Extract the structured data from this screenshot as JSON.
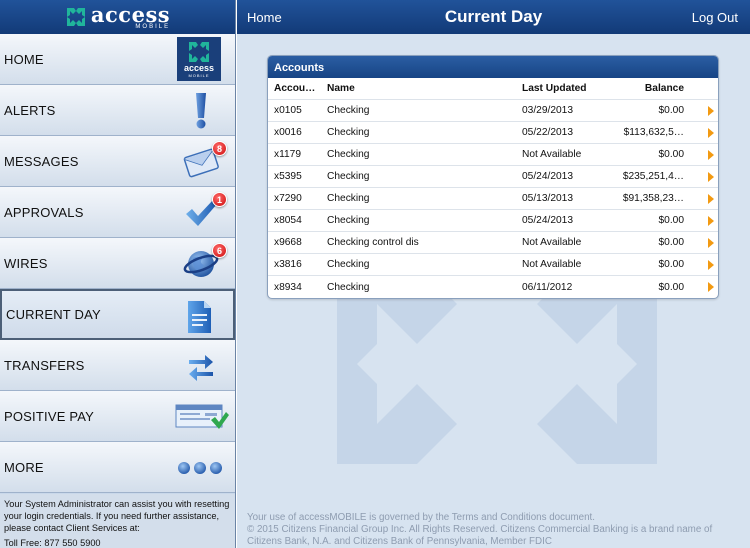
{
  "brand": {
    "name": "access",
    "sub": "MOBILE"
  },
  "header": {
    "home_label": "Home",
    "title": "Current Day",
    "logout_label": "Log Out"
  },
  "sidebar": {
    "items": [
      {
        "label": "HOME",
        "icon": "access-logo-icon"
      },
      {
        "label": "ALERTS",
        "icon": "exclamation-icon"
      },
      {
        "label": "MESSAGES",
        "icon": "envelope-icon",
        "badge": "8"
      },
      {
        "label": "APPROVALS",
        "icon": "checkmark-icon",
        "badge": "1"
      },
      {
        "label": "WIRES",
        "icon": "globe-icon",
        "badge": "6"
      },
      {
        "label": "CURRENT DAY",
        "icon": "document-icon"
      },
      {
        "label": "TRANSFERS",
        "icon": "arrows-exchange-icon"
      },
      {
        "label": "POSITIVE PAY",
        "icon": "check-approved-icon"
      },
      {
        "label": "MORE",
        "icon": "dots-icon"
      }
    ],
    "help_text": "Your System Administrator can assist you with resetting your login credentials. If you need further assistance, please contact Client Services at:",
    "help_extra": "Toll Free: 877 550 5900"
  },
  "accounts": {
    "title": "Accounts",
    "columns": {
      "account": "Accou…",
      "name": "Name",
      "updated": "Last Updated",
      "balance": "Balance"
    },
    "rows": [
      {
        "account": "x0105",
        "name": "Checking",
        "updated": "03/29/2013",
        "balance": "$0.00"
      },
      {
        "account": "x0016",
        "name": "Checking",
        "updated": "05/22/2013",
        "balance": "$113,632,5…"
      },
      {
        "account": "x1179",
        "name": "Checking",
        "updated": "Not Available",
        "balance": "$0.00"
      },
      {
        "account": "x5395",
        "name": "Checking",
        "updated": "05/24/2013",
        "balance": "$235,251,4…"
      },
      {
        "account": "x7290",
        "name": "Checking",
        "updated": "05/13/2013",
        "balance": "$91,358,23…"
      },
      {
        "account": "x8054",
        "name": "Checking",
        "updated": "05/24/2013",
        "balance": "$0.00"
      },
      {
        "account": "x9668",
        "name": "Checking control dis",
        "updated": "Not Available",
        "balance": "$0.00"
      },
      {
        "account": "x3816",
        "name": "Checking",
        "updated": "Not Available",
        "balance": "$0.00"
      },
      {
        "account": "x8934",
        "name": "Checking",
        "updated": "06/11/2012",
        "balance": "$0.00"
      }
    ]
  },
  "footer": {
    "line1": "Your use of accessMOBILE is governed by the Terms and Conditions document.",
    "line2": "© 2015 Citizens Financial Group Inc. All Rights Reserved. Citizens Commercial Banking is a brand name of Citizens Bank, N.A. and Citizens Bank of Pennsylvania, Member FDIC"
  },
  "colors": {
    "brand_blue": "#1b4a8e",
    "accent_orange": "#f29a12",
    "badge_red": "#cc0b0b",
    "brand_green": "#1aa88f"
  }
}
